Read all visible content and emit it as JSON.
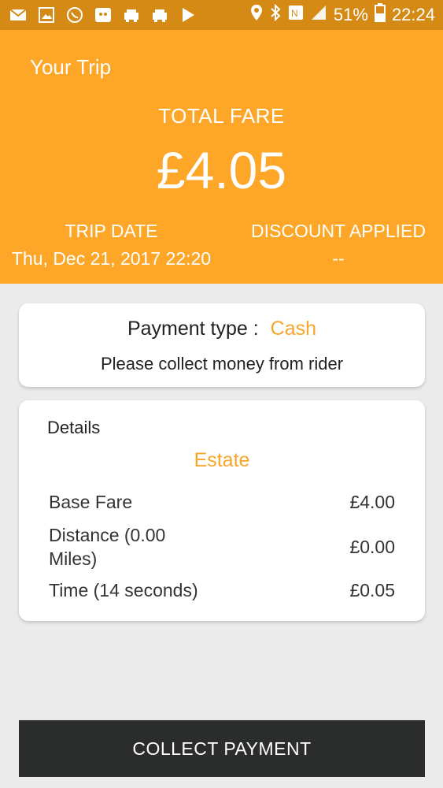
{
  "status_bar": {
    "battery_percent": "51%",
    "time": "22:24",
    "icons": [
      "mail-icon",
      "image-icon",
      "whatsapp-icon",
      "game-icon",
      "car-icon",
      "car-icon",
      "play-store-icon",
      "location-icon",
      "bluetooth-icon",
      "nfc-icon",
      "signal-icon",
      "battery-icon"
    ]
  },
  "header": {
    "title": "Your Trip",
    "total_fare_label": "TOTAL FARE",
    "total_fare_amount": "£4.05",
    "trip_date_label": "TRIP DATE",
    "trip_date_value": "Thu, Dec 21, 2017 22:20",
    "discount_label": "DISCOUNT APPLIED",
    "discount_value": "--"
  },
  "payment": {
    "label": "Payment type :",
    "value": "Cash",
    "note": "Please collect money from rider"
  },
  "details": {
    "title": "Details",
    "vehicle_type": "Estate",
    "rows": [
      {
        "name": "Base Fare",
        "amount": "£4.00"
      },
      {
        "name": "Distance (0.00 Miles)",
        "amount": "£0.00"
      },
      {
        "name": "Time (14 seconds)",
        "amount": "£0.05"
      }
    ]
  },
  "actions": {
    "collect_label": "COLLECT PAYMENT"
  },
  "colors": {
    "header": "#fda628",
    "status_bar": "#d68a16",
    "accent": "#f8a62a",
    "button": "#2b2d2d"
  }
}
